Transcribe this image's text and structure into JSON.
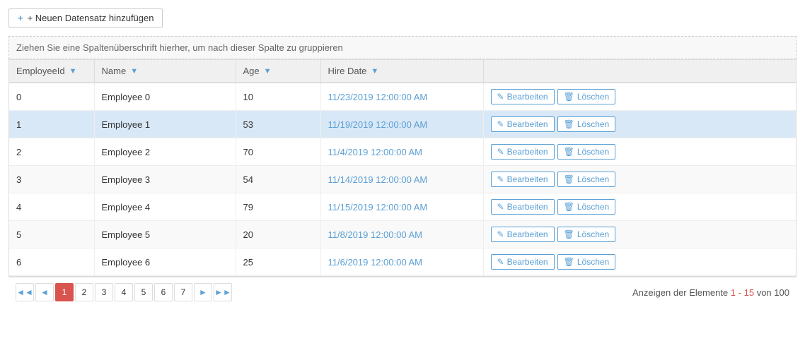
{
  "toolbar": {
    "add_button_label": "+ Neuen Datensatz hinzufügen"
  },
  "group_hint": "Ziehen Sie eine Spaltenüberschrift hierher, um nach dieser Spalte zu gruppieren",
  "table": {
    "columns": [
      {
        "key": "employeeId",
        "label": "EmployeeId",
        "filterable": true
      },
      {
        "key": "name",
        "label": "Name",
        "filterable": true
      },
      {
        "key": "age",
        "label": "Age",
        "filterable": true
      },
      {
        "key": "hireDate",
        "label": "Hire Date",
        "filterable": true
      },
      {
        "key": "actions",
        "label": "",
        "filterable": false
      }
    ],
    "rows": [
      {
        "id": "0",
        "name": "Employee 0",
        "age": "10",
        "hireDate": "11/23/2019 12:00:00 AM",
        "highlighted": false
      },
      {
        "id": "1",
        "name": "Employee 1",
        "age": "53",
        "hireDate": "11/19/2019 12:00:00 AM",
        "highlighted": true
      },
      {
        "id": "2",
        "name": "Employee 2",
        "age": "70",
        "hireDate": "11/4/2019 12:00:00 AM",
        "highlighted": false
      },
      {
        "id": "3",
        "name": "Employee 3",
        "age": "54",
        "hireDate": "11/14/2019 12:00:00 AM",
        "highlighted": false
      },
      {
        "id": "4",
        "name": "Employee 4",
        "age": "79",
        "hireDate": "11/15/2019 12:00:00 AM",
        "highlighted": false
      },
      {
        "id": "5",
        "name": "Employee 5",
        "age": "20",
        "hireDate": "11/8/2019 12:00:00 AM",
        "highlighted": false
      },
      {
        "id": "6",
        "name": "Employee 6",
        "age": "25",
        "hireDate": "11/6/2019 12:00:00 AM",
        "highlighted": false
      }
    ],
    "buttons": {
      "edit": "Bearbeiten",
      "delete": "Löschen"
    }
  },
  "pagination": {
    "pages": [
      "1",
      "2",
      "3",
      "4",
      "5",
      "6",
      "7"
    ],
    "active_page": "1",
    "range_text": "Anzeigen der Elemente",
    "range_start": "1",
    "range_end": "15",
    "total": "100",
    "range_connector": " - ",
    "of_text": "von"
  }
}
